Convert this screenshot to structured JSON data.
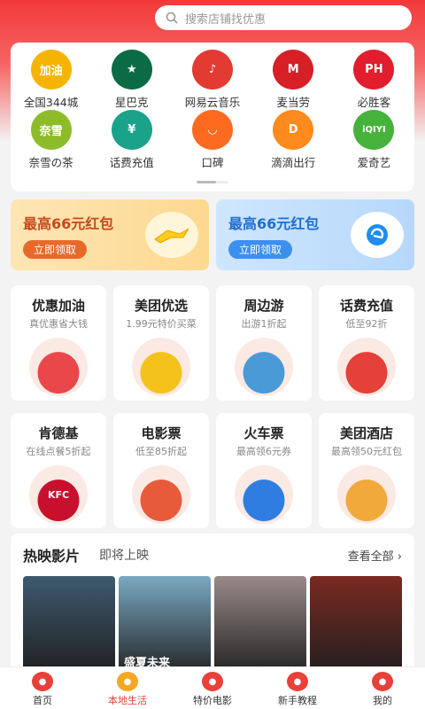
{
  "search": {
    "placeholder": "搜索店铺找优惠"
  },
  "quick_icons": [
    {
      "label": "全国344城",
      "icon": "fuel-icon",
      "color": "#f6b400",
      "glyph": "加油"
    },
    {
      "label": "星巴克",
      "icon": "starbucks-icon",
      "color": "#0b6b45",
      "glyph": "★"
    },
    {
      "label": "网易云音乐",
      "icon": "netease-music-icon",
      "color": "#e33a32",
      "glyph": "♪"
    },
    {
      "label": "麦当劳",
      "icon": "mcdonalds-icon",
      "color": "#d71f26",
      "glyph": "M"
    },
    {
      "label": "必胜客",
      "icon": "pizzahut-icon",
      "color": "#e21d2e",
      "glyph": "PH"
    },
    {
      "label": "奈雪の茶",
      "icon": "nayuki-icon",
      "color": "#8cbc2a",
      "glyph": "奈雪"
    },
    {
      "label": "话费充值",
      "icon": "phone-topup-icon",
      "color": "#1aa38a",
      "glyph": "¥"
    },
    {
      "label": "口碑",
      "icon": "koubei-icon",
      "color": "#ff6a21",
      "glyph": "◡"
    },
    {
      "label": "滴滴出行",
      "icon": "didi-icon",
      "color": "#ff8a1d",
      "glyph": "D"
    },
    {
      "label": "爱奇艺",
      "icon": "iqiyi-icon",
      "color": "#47b23b",
      "glyph": "iQIYI"
    }
  ],
  "promos": [
    {
      "title": "最高66元红包",
      "button": "立即领取",
      "icon": "fliggy-icon"
    },
    {
      "title": "最高66元红包",
      "button": "立即领取",
      "icon": "eleme-icon"
    }
  ],
  "services_row1": [
    {
      "title": "优惠加油",
      "sub": "真优惠省大钱",
      "icon": "fuel-can-icon",
      "color": "#e9474a"
    },
    {
      "title": "美团优选",
      "sub": "1.99元特价买菜",
      "icon": "grocery-bag-icon",
      "color": "#f4c21a"
    },
    {
      "title": "周边游",
      "sub": "出游1折起",
      "icon": "travel-icon",
      "color": "#4a9ad8"
    },
    {
      "title": "话费充值",
      "sub": "低至92折",
      "icon": "red-envelope-icon",
      "color": "#e6403a"
    }
  ],
  "services_row2": [
    {
      "title": "肯德基",
      "sub": "在线点餐5折起",
      "icon": "kfc-icon",
      "color": "#c8102e",
      "glyph": "KFC"
    },
    {
      "title": "电影票",
      "sub": "低至85折起",
      "icon": "popcorn-icon",
      "color": "#e85b3a"
    },
    {
      "title": "火车票",
      "sub": "最高领6元券",
      "icon": "train-icon",
      "color": "#2f7de0"
    },
    {
      "title": "美团酒店",
      "sub": "最高领50元红包",
      "icon": "hotel-icon",
      "color": "#f0a93a"
    }
  ],
  "movies": {
    "tab_now": "热映影片",
    "tab_soon": "即将上映",
    "see_all": "查看全部",
    "posters": [
      {
        "caption": "",
        "color": "#3e5a6e"
      },
      {
        "caption": "盛夏未来",
        "color": "#7aa9c2"
      },
      {
        "caption": "",
        "color": "#9a8a8a"
      },
      {
        "caption": "",
        "color": "#7a2a22"
      }
    ]
  },
  "tabbar": [
    {
      "label": "首页",
      "icon": "home-icon",
      "active": false
    },
    {
      "label": "本地生活",
      "icon": "local-life-icon",
      "active": true
    },
    {
      "label": "特价电影",
      "icon": "movie-deal-icon",
      "active": false
    },
    {
      "label": "新手教程",
      "icon": "tutorial-icon",
      "active": false
    },
    {
      "label": "我的",
      "icon": "profile-icon",
      "active": false
    }
  ]
}
